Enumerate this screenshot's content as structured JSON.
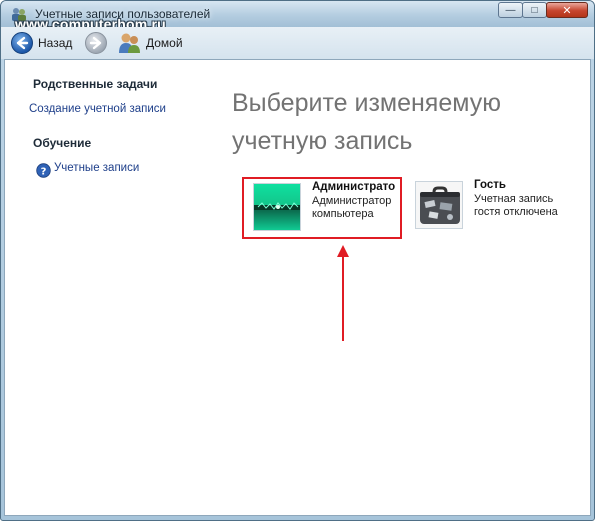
{
  "window": {
    "title": "Учетные записи пользователей",
    "watermark": "www.computerhom.ru",
    "buttons": {
      "minimize": "—",
      "maximize": "□",
      "close": "✕"
    }
  },
  "navbar": {
    "back_label": "Назад",
    "home_label": "Домой"
  },
  "sidebar": {
    "related_heading": "Родственные задачи",
    "create_account_link": "Создание учетной записи",
    "learning_heading": "Обучение",
    "accounts_help_link": "Учетные записи"
  },
  "main": {
    "title": "Выберите изменяемую учетную запись",
    "accounts": [
      {
        "name": "Администрато",
        "description": "Администратор компьютера"
      },
      {
        "name": "Гость",
        "description": "Учетная запись гостя отключена"
      }
    ]
  },
  "colors": {
    "highlight": "#e01c24",
    "link": "#1e3f8a",
    "title_gray": "#737373"
  },
  "icons": [
    "users-icon",
    "back-arrow-icon",
    "forward-arrow-icon",
    "home-users-icon",
    "help-icon",
    "admin-picture",
    "guest-briefcase-picture",
    "pointer-arrow"
  ]
}
